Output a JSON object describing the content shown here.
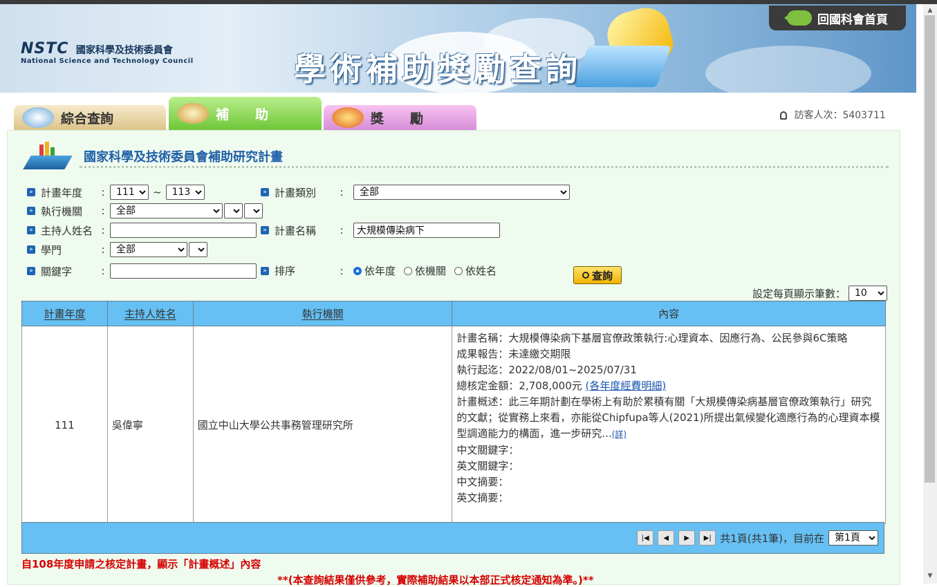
{
  "header": {
    "logo_abbr": "NSTC",
    "org_name_cn": "國家科學及技術委員會",
    "org_name_en": "National Science and Technology Council",
    "site_title": "學術補助獎勵查詢",
    "home_link": "回國科會首頁"
  },
  "tabs": [
    {
      "label": "綜合查詢"
    },
    {
      "label": "補　　助"
    },
    {
      "label": "獎　　勵"
    }
  ],
  "visitor": {
    "label": "訪客人次：5403711"
  },
  "panel": {
    "title": "國家科學及技術委員會補助研究計畫"
  },
  "form": {
    "year_label": "計畫年度",
    "year_from": "111",
    "year_sep": "~",
    "year_to": "113",
    "category_label": "計畫類別",
    "category_value": "全部",
    "org_label": "執行機關",
    "org_value": "全部",
    "pi_label": "主持人姓名",
    "pi_value": "",
    "plan_name_label": "計畫名稱",
    "plan_name_value": "大規模傳染病下",
    "discipline_label": "學門",
    "discipline_value": "全部",
    "keyword_label": "關鍵字",
    "keyword_value": "",
    "sort_label": "排序",
    "sort_options": [
      "依年度",
      "依機關",
      "依姓名"
    ],
    "search_button": "查詢",
    "per_page_label": "設定每頁顯示筆數：",
    "per_page_value": "10"
  },
  "table": {
    "headers": [
      "計畫年度",
      "主持人姓名",
      "執行機關",
      "內容"
    ],
    "row": {
      "year": "111",
      "pi": "吳偉寧",
      "org": "國立中山大學公共事務管理研究所",
      "plan_name": "計畫名稱：大規模傳染病下基層官僚政策執行:心理資本、因應行為、公民參與6C策略",
      "report": "成果報告：未達繳交期限",
      "period": "執行起迄：2022/08/01~2025/07/31",
      "amount": "總核定金額：2,708,000元",
      "amount_link": "(各年度經費明細)",
      "summary": "計畫概述：此三年期計劃在學術上有助於累積有關「大規模傳染病基層官僚政策執行」研究的文獻；從實務上來看，亦能從Chipfupa等人(2021)所提出氣候變化適應行為的心理資本模型調適能力的構面，進一步研究...",
      "summary_more": "(詳)",
      "kw_cn": "中文關鍵字：",
      "kw_en": "英文關鍵字：",
      "abs_cn": "中文摘要：",
      "abs_en": "英文摘要："
    }
  },
  "pager": {
    "info": "共1頁(共1筆)，目前在",
    "page_value": "第1頁"
  },
  "notes": {
    "note1": "自108年度申請之核定計畫，顯示「計畫概述」內容",
    "note2": "**(本查詢結果僅供參考，實際補助結果以本部正式核定通知為準。)**"
  },
  "colors": {
    "header_blue": "#66c0f3",
    "panel_bg": "#effbef",
    "title_blue": "#1f5fa8",
    "note_red": "#d60000"
  }
}
